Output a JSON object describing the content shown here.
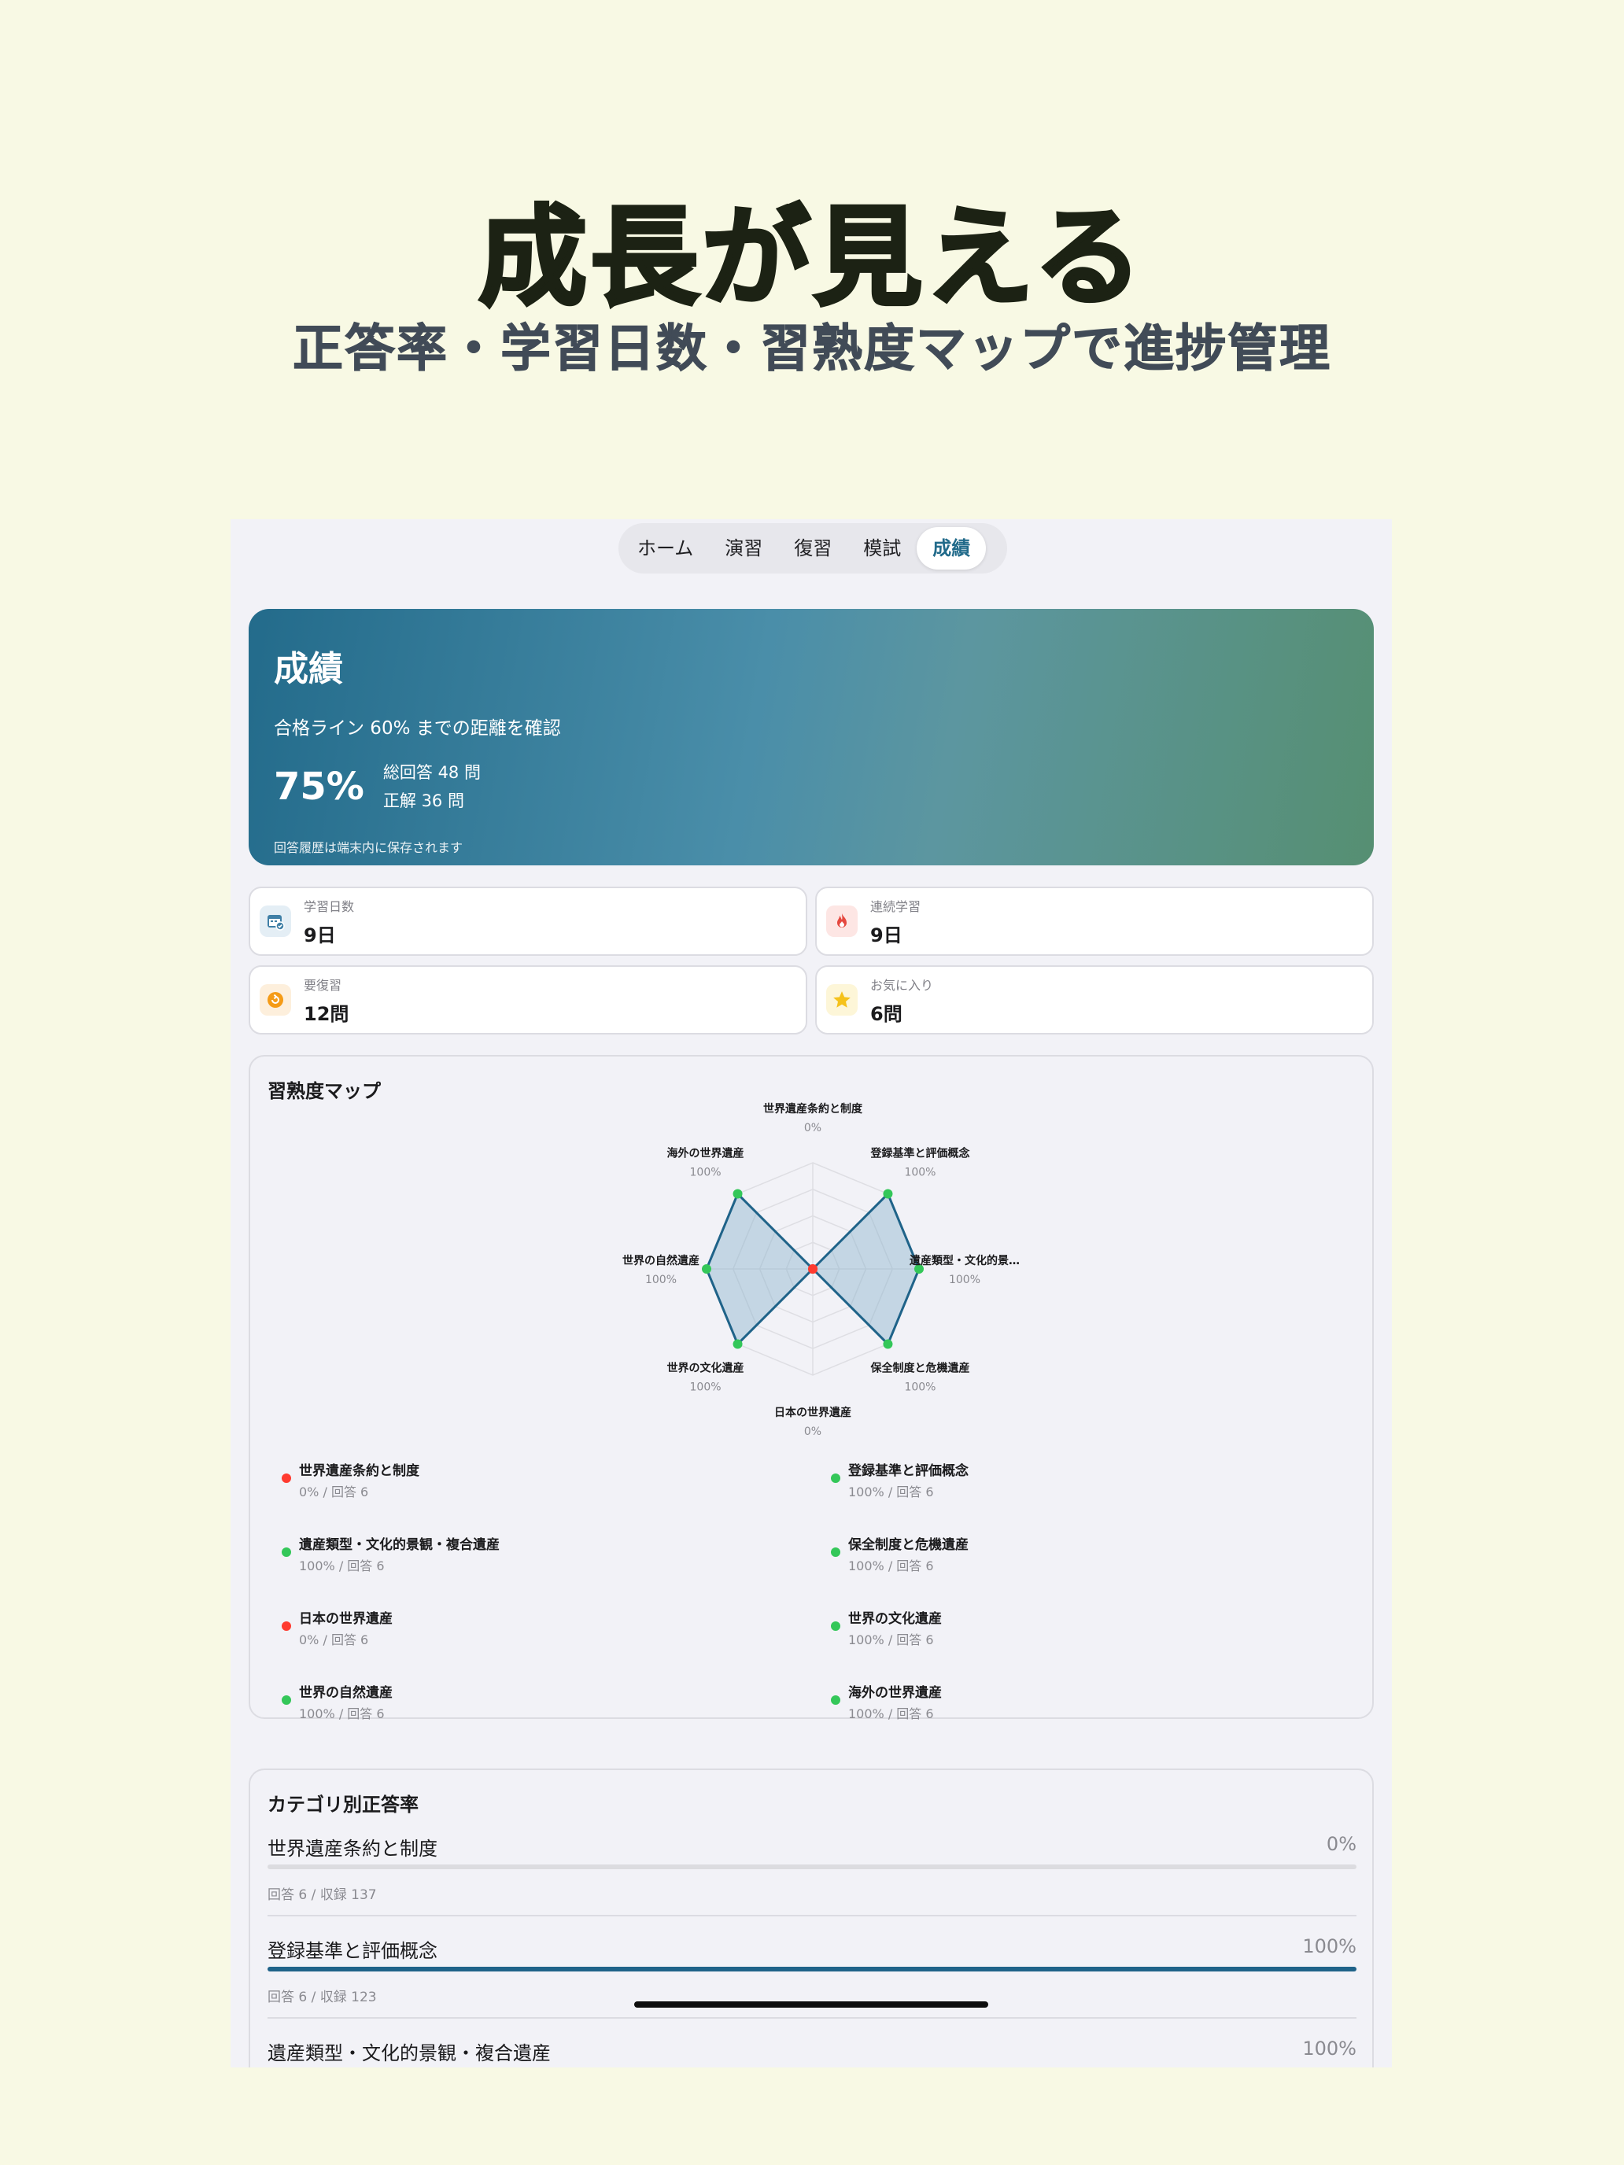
{
  "promo": {
    "headline": "成長が見える",
    "subhead": "正答率・学習日数・習熟度マップで進捗管理"
  },
  "tabs": [
    {
      "label": "ホーム",
      "active": false
    },
    {
      "label": "演習",
      "active": false
    },
    {
      "label": "復習",
      "active": false
    },
    {
      "label": "模試",
      "active": false
    },
    {
      "label": "成績",
      "active": true
    }
  ],
  "hero": {
    "title": "成績",
    "subtitle": "合格ライン 60% までの距離を確認",
    "accuracy": "75%",
    "total_answers": "総回答 48 問",
    "correct_answers": "正解 36 問",
    "note": "回答履歴は端末内に保存されます"
  },
  "stats": [
    {
      "label": "学習日数",
      "value": "9日",
      "icon": "calendar-check-icon",
      "color": "#3f7fa6"
    },
    {
      "label": "連続学習",
      "value": "9日",
      "icon": "flame-icon",
      "color": "#e5483f"
    },
    {
      "label": "要復習",
      "value": "12問",
      "icon": "review-arrow-icon",
      "color": "#f59b16"
    },
    {
      "label": "お気に入り",
      "value": "6問",
      "icon": "star-icon",
      "color": "#f5c21b"
    }
  ],
  "mastery_map": {
    "title": "習熟度マップ",
    "colors": {
      "good": "#34c759",
      "bad": "#ff3b30",
      "stroke": "#1f6389",
      "fill": "#8bb3cc"
    },
    "axes": [
      {
        "label": "世界遺産条約と制度",
        "value": 0,
        "percent_text": "0%"
      },
      {
        "label": "登録基準と評価概念",
        "value": 100,
        "percent_text": "100%"
      },
      {
        "label": "遺産類型・文化的景…",
        "value": 100,
        "percent_text": "100%"
      },
      {
        "label": "保全制度と危機遺産",
        "value": 100,
        "percent_text": "100%"
      },
      {
        "label": "日本の世界遺産",
        "value": 0,
        "percent_text": "0%"
      },
      {
        "label": "世界の文化遺産",
        "value": 100,
        "percent_text": "100%"
      },
      {
        "label": "世界の自然遺産",
        "value": 100,
        "percent_text": "100%"
      },
      {
        "label": "海外の世界遺産",
        "value": 100,
        "percent_text": "100%"
      }
    ],
    "legend": [
      {
        "name": "世界遺産条約と制度",
        "detail": "0% / 回答 6",
        "status": "bad"
      },
      {
        "name": "登録基準と評価概念",
        "detail": "100% / 回答 6",
        "status": "good"
      },
      {
        "name": "遺産類型・文化的景観・複合遺産",
        "detail": "100% / 回答 6",
        "status": "good"
      },
      {
        "name": "保全制度と危機遺産",
        "detail": "100% / 回答 6",
        "status": "good"
      },
      {
        "name": "日本の世界遺産",
        "detail": "0% / 回答 6",
        "status": "bad"
      },
      {
        "name": "世界の文化遺産",
        "detail": "100% / 回答 6",
        "status": "good"
      },
      {
        "name": "世界の自然遺産",
        "detail": "100% / 回答 6",
        "status": "good"
      },
      {
        "name": "海外の世界遺産",
        "detail": "100% / 回答 6",
        "status": "good"
      }
    ]
  },
  "category_accuracy": {
    "title": "カテゴリ別正答率",
    "rows": [
      {
        "name": "世界遺産条約と制度",
        "percent_text": "0%",
        "ratio": 0,
        "meta": "回答 6 / 収録 137"
      },
      {
        "name": "登録基準と評価概念",
        "percent_text": "100%",
        "ratio": 1,
        "meta": "回答 6 / 収録 123"
      },
      {
        "name": "遺産類型・文化的景観・複合遺産",
        "percent_text": "100%",
        "ratio": 1,
        "meta": ""
      }
    ]
  }
}
